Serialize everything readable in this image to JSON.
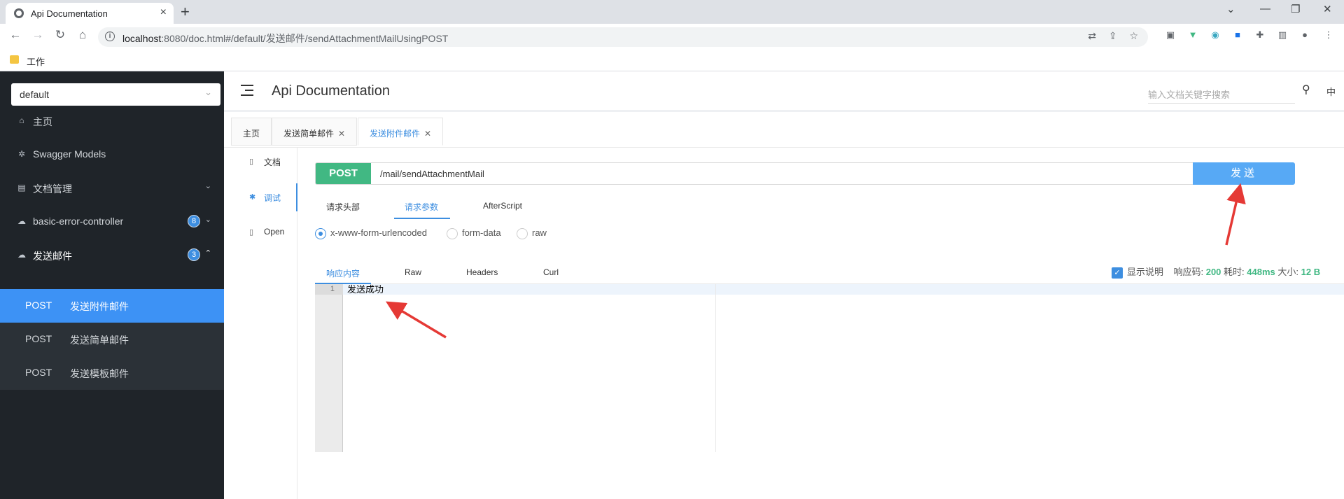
{
  "browser": {
    "tab_title": "Api Documentation",
    "url_host": "localhost",
    "url_path": ":8080/doc.html#/default/发送邮件/sendAttachmentMailUsingPOST",
    "bookmark": "工作"
  },
  "sidebar": {
    "group_select": "default",
    "items": [
      {
        "label": "主页",
        "icon": "home-icon"
      },
      {
        "label": "Swagger Models",
        "icon": "models-icon"
      },
      {
        "label": "文档管理",
        "icon": "doc-manage-icon"
      },
      {
        "label": "basic-error-controller",
        "icon": "cloud-icon",
        "badge": "8"
      },
      {
        "label": "发送邮件",
        "icon": "cloud-icon",
        "badge": "3"
      }
    ],
    "sub_items": [
      {
        "method": "POST",
        "label": "发送附件邮件",
        "active": true
      },
      {
        "method": "POST",
        "label": "发送简单邮件"
      },
      {
        "method": "POST",
        "label": "发送模板邮件"
      }
    ]
  },
  "header": {
    "title": "Api Documentation",
    "search_placeholder": "输入文档关键字搜索",
    "lang": "中"
  },
  "doc_tabs": [
    {
      "label": "主页"
    },
    {
      "label": "发送简单邮件",
      "closable": true
    },
    {
      "label": "发送附件邮件",
      "closable": true,
      "active": true
    }
  ],
  "left_nav": [
    {
      "label": "文档"
    },
    {
      "label": "调试",
      "active": true
    },
    {
      "label": "Open"
    }
  ],
  "request": {
    "method": "POST",
    "path": "/mail/sendAttachmentMail",
    "send_label": "发送"
  },
  "request_tabs": [
    "请求头部",
    "请求参数",
    "AfterScript"
  ],
  "content_types": [
    "x-www-form-urlencoded",
    "form-data",
    "raw"
  ],
  "response_tabs": [
    "响应内容",
    "Raw",
    "Headers",
    "Curl"
  ],
  "response_meta": {
    "show_desc": "显示说明",
    "code_label": "响应码:",
    "code": "200",
    "time_label": "耗时:",
    "time": "448ms",
    "size_label": "大小:",
    "size": "12 B"
  },
  "response_body": {
    "line_no": "1",
    "text": "发送成功"
  },
  "colors": {
    "accent": "#3d8ee0",
    "post": "#41b883",
    "annotation": "#e53935"
  }
}
